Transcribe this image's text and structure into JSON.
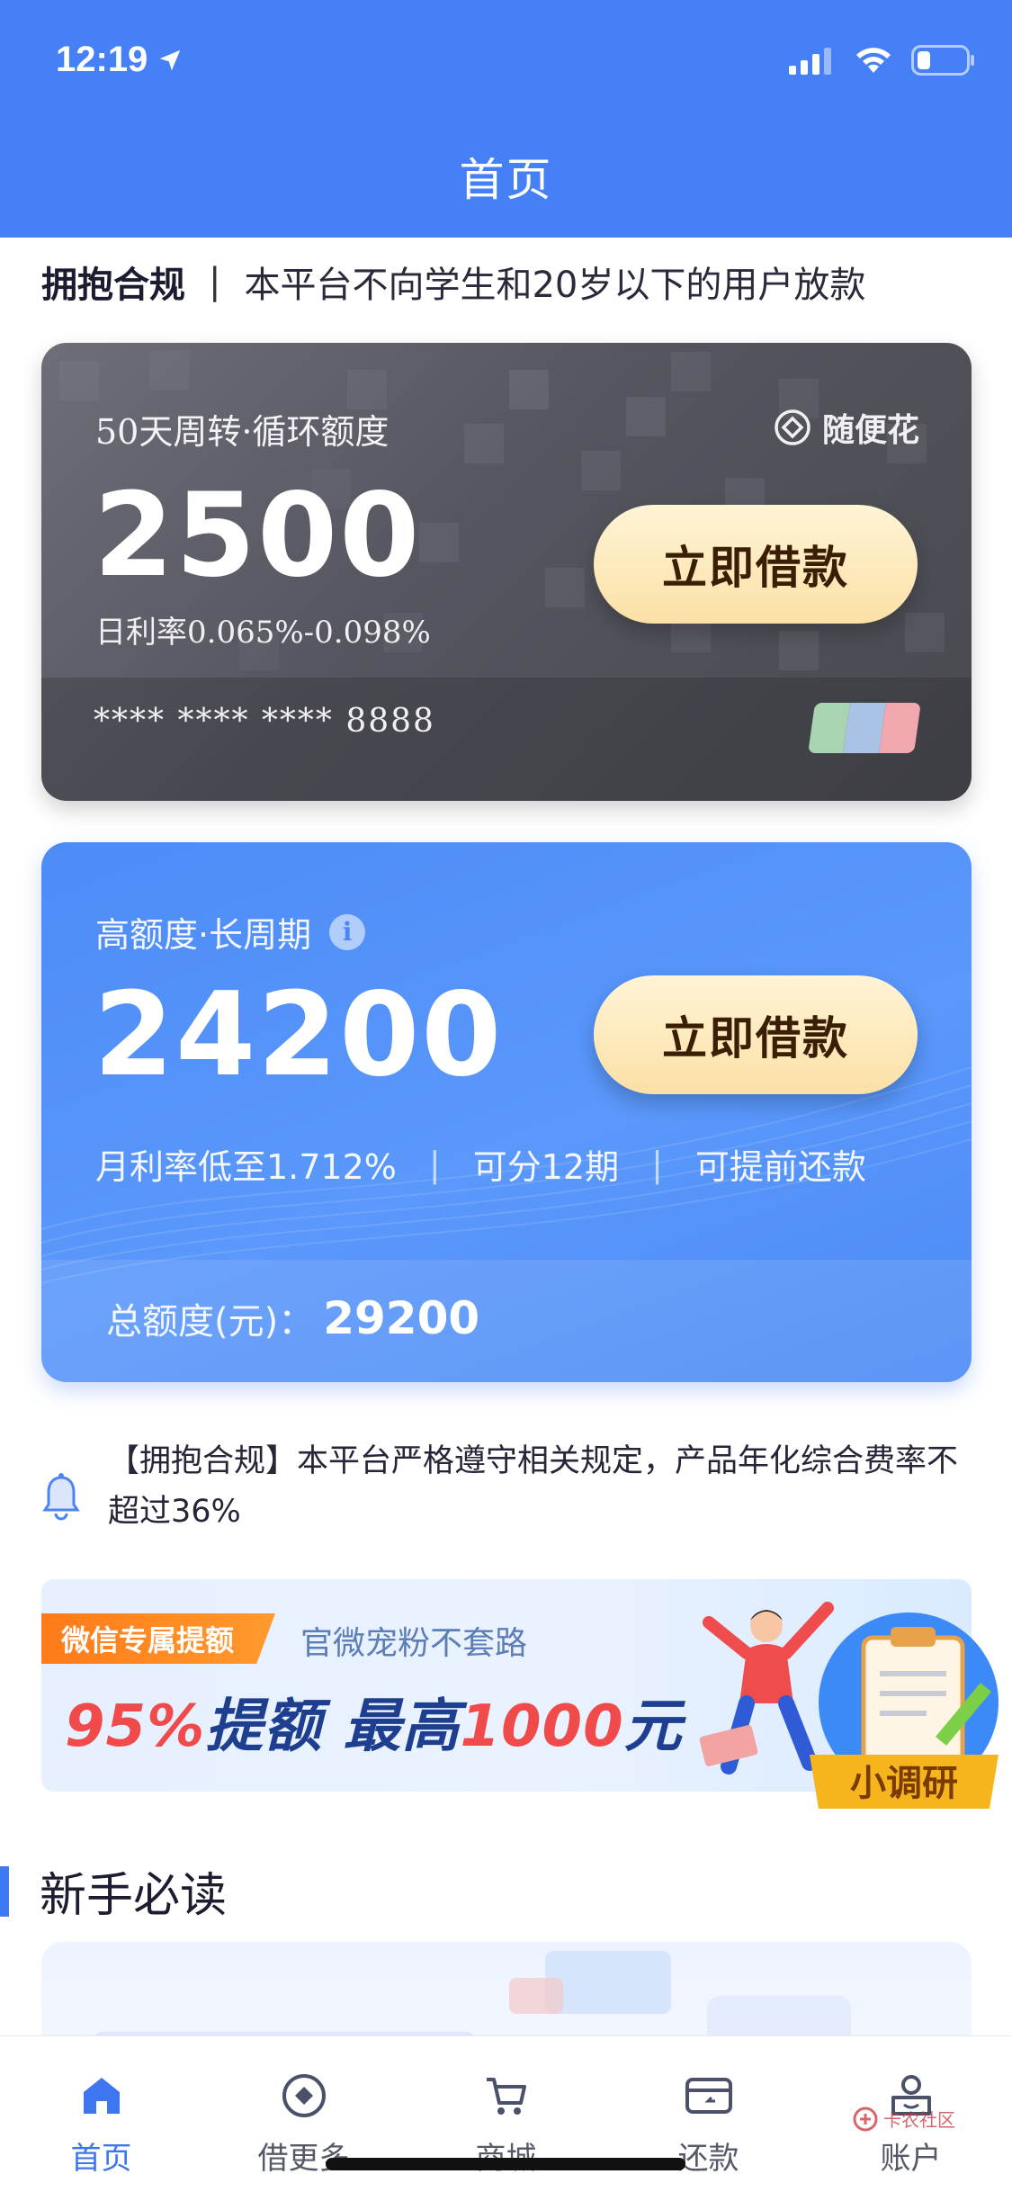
{
  "status_bar": {
    "time": "12:19"
  },
  "header": {
    "title": "首页"
  },
  "compliance": {
    "label": "拥抱合规",
    "separator": "|",
    "text": "本平台不向学生和20岁以下的用户放款"
  },
  "card_revolving": {
    "subtitle": "50天周转·循环额度",
    "brand": "随便花",
    "amount": "2500",
    "rate": "日利率0.065%-0.098%",
    "card_number": "**** **** **** 8888",
    "button": "立即借款"
  },
  "card_high": {
    "subtitle": "高额度·长周期",
    "amount": "24200",
    "features": [
      "月利率低至1.712%",
      "可分12期",
      "可提前还款"
    ],
    "separator": "|",
    "total_label": "总额度(元)：",
    "total_value": "29200",
    "button": "立即借款"
  },
  "notice": {
    "text": "【拥抱合规】本平台严格遵守相关规定，产品年化综合费率不超过36%"
  },
  "banner": {
    "tag": "微信专属提额",
    "tag_sub": "官微宠粉不套路",
    "headline_red": "95%",
    "headline_mid": "提额 最高",
    "headline_red2": "1000",
    "headline_end": "元",
    "badge": "小调研"
  },
  "section": {
    "title": "新手必读"
  },
  "tabs": [
    {
      "label": "首页",
      "icon": "home-icon",
      "active": true
    },
    {
      "label": "借更多",
      "icon": "borrow-more-icon",
      "active": false
    },
    {
      "label": "商城",
      "icon": "cart-icon",
      "active": false
    },
    {
      "label": "还款",
      "icon": "repay-card-icon",
      "active": false
    },
    {
      "label": "账户",
      "icon": "account-icon",
      "active": false
    }
  ],
  "watermark": "卡农社区",
  "colors": {
    "primary": "#4580f7",
    "gold_button": "#fbe0a6",
    "accent_red": "#f04a4a",
    "tag_orange": "#ff7a19"
  }
}
